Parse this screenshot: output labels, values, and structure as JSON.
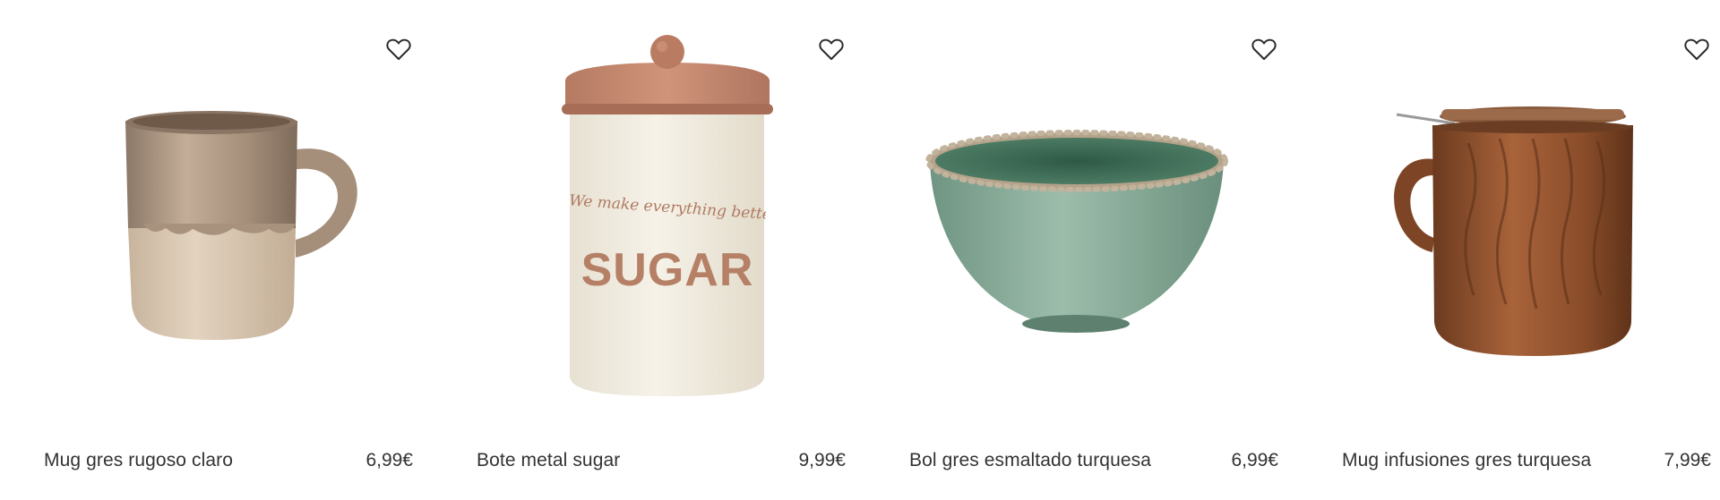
{
  "products": [
    {
      "name": "Mug gres rugoso claro",
      "price": "6,99€",
      "image": "beige-stoneware-mug",
      "wishlist_icon": "heart-outline-icon"
    },
    {
      "name": "Bote metal sugar",
      "price": "9,99€",
      "image": "sugar-canister",
      "label_script": "We make everything better",
      "label_main": "SUGAR",
      "wishlist_icon": "heart-outline-icon"
    },
    {
      "name": "Bol gres esmaltado turquesa",
      "price": "6,99€",
      "image": "green-glazed-bowl",
      "wishlist_icon": "heart-outline-icon"
    },
    {
      "name": "Mug infusiones gres turquesa",
      "price": "7,99€",
      "image": "brown-infusion-mug",
      "wishlist_icon": "heart-outline-icon"
    }
  ],
  "colors": {
    "text": "#333333",
    "heart_stroke": "#2b2b2b",
    "background": "#ffffff"
  }
}
